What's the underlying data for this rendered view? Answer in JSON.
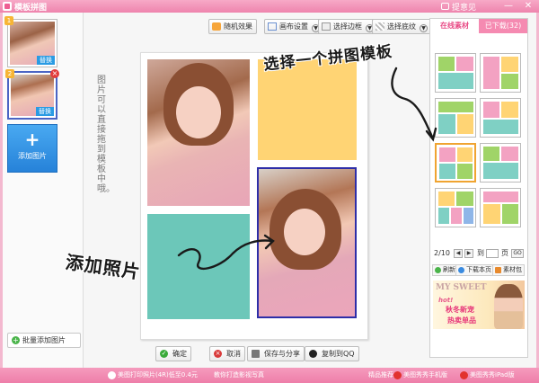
{
  "window": {
    "title": "模板拼图",
    "feedback": "提意见",
    "minimize": "—",
    "close": "✕"
  },
  "sidebar": {
    "thumbnails": [
      {
        "number": "1",
        "replace_label": "替换"
      },
      {
        "number": "2",
        "replace_label": "替换"
      }
    ],
    "add_photo_label": "添加图片",
    "batch_add_label": "批量添加图片"
  },
  "toolbar": {
    "random_effect": "随机效果",
    "canvas_settings": "画布设置",
    "select_border": "选择边框",
    "select_background": "选择底纹"
  },
  "canvas": {
    "hint_text": "图片可以直接拖到模板中哦。"
  },
  "annotations": {
    "select_template": "选择一个拼图模板",
    "add_photo": "添加照片"
  },
  "actions": {
    "confirm": "确定",
    "cancel": "取消",
    "save_share": "保存与分享",
    "copy_qq": "复制到QQ"
  },
  "panel": {
    "tabs": {
      "online": "在线素材",
      "downloaded": "已下载(32)"
    },
    "pager": {
      "current": "2/10",
      "goto_label": "到",
      "page_label": "页",
      "go_label": "GO"
    },
    "buttons": {
      "refresh": "刷新",
      "download_page": "下载本页",
      "material_pack": "素材包"
    },
    "ad": {
      "line1": "MY SWEET",
      "line2": "hot!",
      "line3": "秋冬新宠",
      "line4": "热卖单品"
    },
    "selected_template_index": 4
  },
  "statusbar": {
    "left_text": "美图打印照片(4R)低至0.4元",
    "mid_text": "教你打造影视写真",
    "rec_label": "精品推荐:",
    "app1": "美图秀秀手机版",
    "app2": "美图秀秀iPad版"
  },
  "colors": {
    "accent_pink": "#ee84ad",
    "photo_selected_border": "#2e2ea8",
    "template_selected_border": "#f0a431",
    "yellow_cell": "#ffd474",
    "teal_cell": "#6cc7b9"
  }
}
